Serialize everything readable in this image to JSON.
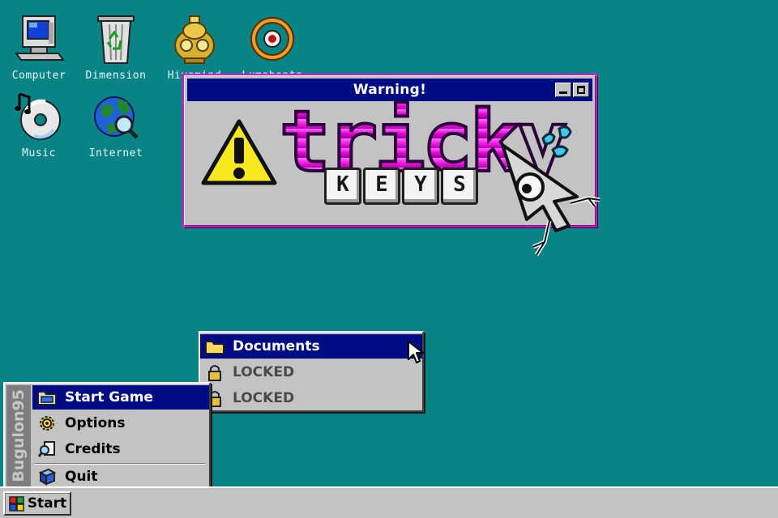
{
  "desktop": {
    "icons": [
      {
        "label": "Computer",
        "icon": "computer-icon"
      },
      {
        "label": "Dimension",
        "icon": "recycle-bin-icon"
      },
      {
        "label": "Hivemind",
        "icon": "golden-idol-icon"
      },
      {
        "label": "Lumabeats",
        "icon": "eye-ring-icon"
      },
      {
        "label": "Music",
        "icon": "music-cd-icon"
      },
      {
        "label": "Internet",
        "icon": "globe-magnifier-icon"
      }
    ]
  },
  "window": {
    "title": "Warning!",
    "logo_word": "tricky",
    "logo_keys": [
      "K",
      "E",
      "Y",
      "S"
    ]
  },
  "start_menu": {
    "brand": "Bugulon95",
    "items": [
      {
        "label": "Start Game",
        "icon": "folder-window-icon",
        "active": true
      },
      {
        "label": "Options",
        "icon": "gear-icon"
      },
      {
        "label": "Credits",
        "icon": "magnifier-document-icon"
      },
      {
        "label": "Quit",
        "icon": "exit-cube-icon"
      }
    ]
  },
  "sub_menu": {
    "items": [
      {
        "label": "Documents",
        "icon": "folder-icon",
        "active": true
      },
      {
        "label": "LOCKED",
        "icon": "lock-icon"
      },
      {
        "label": "LOCKED",
        "icon": "lock-icon"
      }
    ]
  },
  "taskbar": {
    "start_label": "Start"
  },
  "colors": {
    "desktop": "#098486",
    "title_bar": "#000c84",
    "highlight": "#000c84",
    "logo_magenta": "#f21ddf",
    "chrome_gray": "#c3c3c3"
  }
}
